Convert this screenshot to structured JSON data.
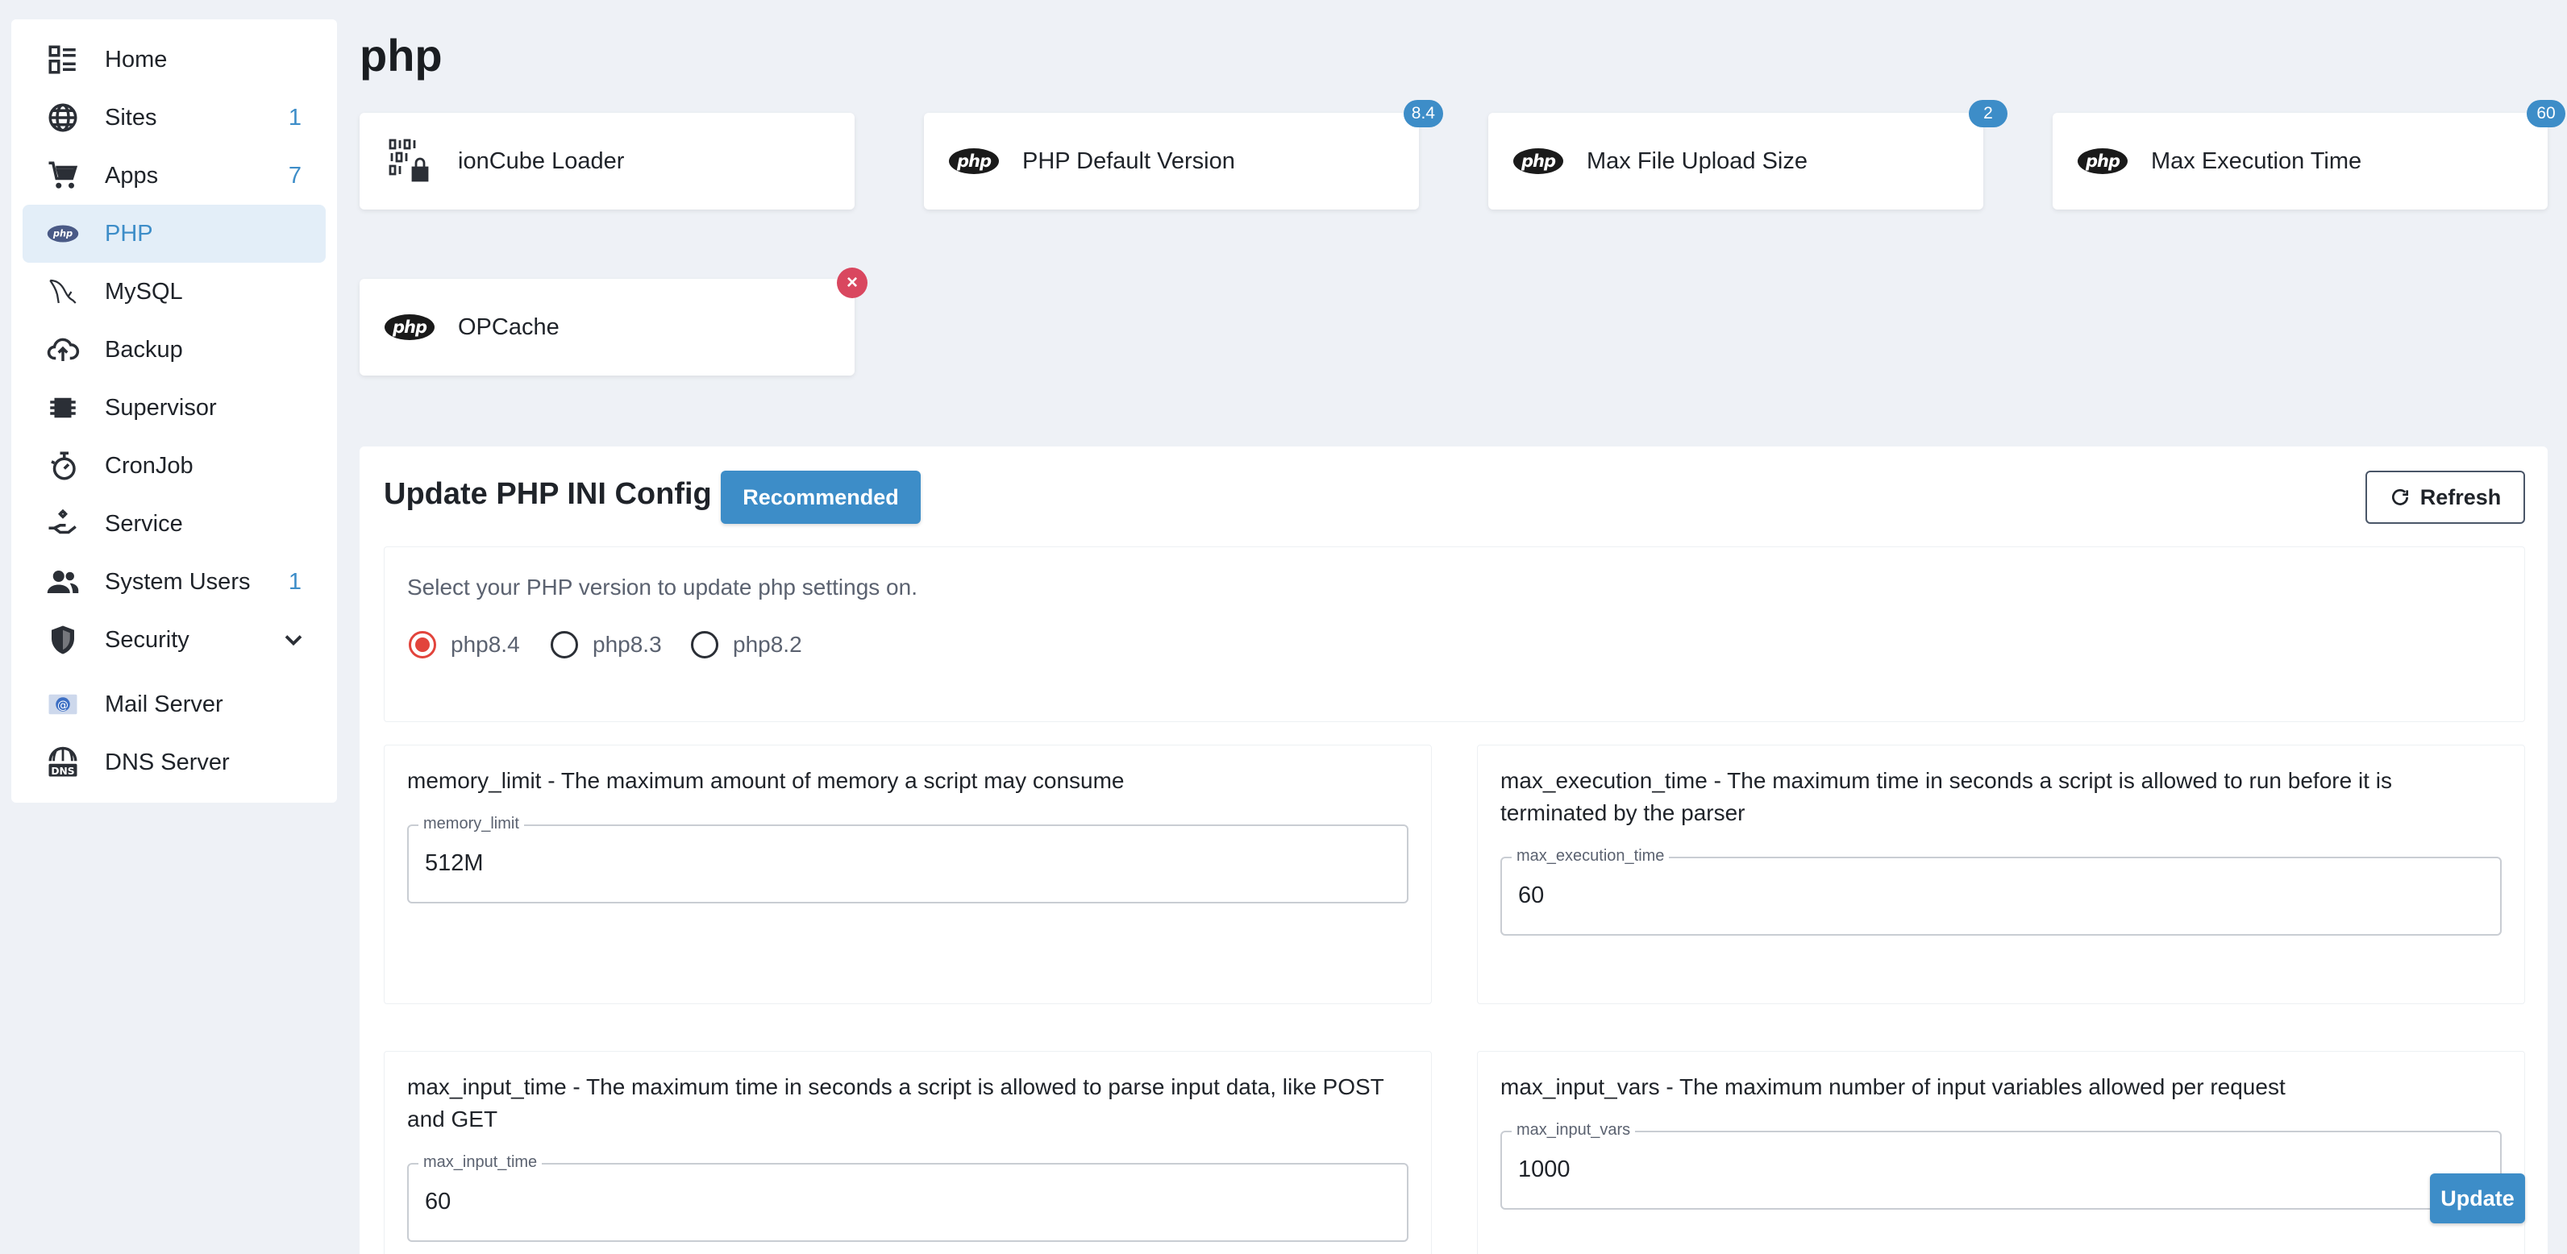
{
  "sidebar": {
    "items": [
      {
        "label": "Home",
        "count": "",
        "icon": "dashboard-icon"
      },
      {
        "label": "Sites",
        "count": "1",
        "icon": "globe-icon"
      },
      {
        "label": "Apps",
        "count": "7",
        "icon": "cart-icon"
      },
      {
        "label": "PHP",
        "count": "",
        "icon": "php-icon",
        "active": true
      },
      {
        "label": "MySQL",
        "count": "",
        "icon": "mysql-dolphin-icon"
      },
      {
        "label": "Backup",
        "count": "",
        "icon": "cloud-upload-icon"
      },
      {
        "label": "Supervisor",
        "count": "",
        "icon": "chip-icon"
      },
      {
        "label": "CronJob",
        "count": "",
        "icon": "timer-icon"
      },
      {
        "label": "Service",
        "count": "",
        "icon": "service-hand-icon"
      },
      {
        "label": "System Users",
        "count": "1",
        "icon": "users-icon"
      },
      {
        "label": "Security",
        "count": "",
        "icon": "shield-icon"
      },
      {
        "label": "Mail Server",
        "count": "",
        "icon": "mail-icon"
      },
      {
        "label": "DNS Server",
        "count": "",
        "icon": "dns-globe-icon"
      }
    ]
  },
  "page": {
    "title": "php"
  },
  "cards": [
    {
      "label": "ionCube Loader",
      "badge": "",
      "icon": "ioncube-icon"
    },
    {
      "label": "PHP Default Version",
      "badge": "8.4",
      "icon": "php-logo-icon"
    },
    {
      "label": "Max File Upload Size",
      "badge": "2",
      "icon": "php-logo-icon"
    },
    {
      "label": "Max Execution Time",
      "badge": "60",
      "icon": "php-logo-icon"
    },
    {
      "label": "OPCache",
      "badge": "×",
      "icon": "php-logo-icon"
    }
  ],
  "php_logo_text": "php",
  "config": {
    "title": "Update PHP INI Config",
    "recommended_label": "Recommended",
    "refresh_label": "Refresh",
    "version_prompt": "Select your PHP version to update php settings on.",
    "versions": [
      "php8.4",
      "php8.3",
      "php8.2"
    ],
    "selected_version": "php8.4",
    "settings": [
      {
        "desc": "memory_limit - The maximum amount of memory a script may consume",
        "label": "memory_limit",
        "value": "512M"
      },
      {
        "desc": "max_execution_time - The maximum time in seconds a script is allowed to run before it is terminated by the parser",
        "label": "max_execution_time",
        "value": "60"
      },
      {
        "desc": "max_input_time - The maximum time in seconds a script is allowed to parse input data, like POST and GET",
        "label": "max_input_time",
        "value": "60"
      },
      {
        "desc": "max_input_vars - The maximum number of input variables allowed per request",
        "label": "max_input_vars",
        "value": "1000"
      }
    ],
    "update_label": "Update"
  },
  "colors": {
    "accent": "#3d8dc8",
    "danger": "#d9475f",
    "radio_active": "#e2443c"
  }
}
